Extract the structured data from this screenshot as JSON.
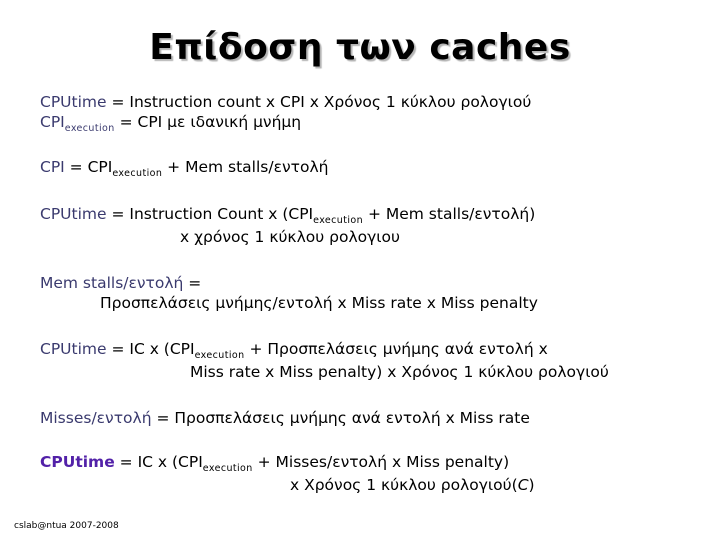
{
  "slide": {
    "title": "Επίδοση των caches",
    "footer": "cslab@ntua 2007-2008",
    "colors": {
      "background": "#ffffff",
      "title": "#000000",
      "title_shadow": "#8c8c8c",
      "lhs_blue": "#3a3a6e",
      "lhs_purple": "#5221a8",
      "body_text": "#000000"
    }
  },
  "equations": {
    "eq1": {
      "lhs": "CPUtime",
      "eq": " =  ",
      "rhs": "Instruction count x CPI  x Χρόνος 1 κύκλου ρολογιού"
    },
    "eq2": {
      "lhs": "CPI",
      "lhs_sub": "execution",
      "eq": "  =  ",
      "rhs": "CPI με ιδανική μνήμη"
    },
    "eq3": {
      "lhs": "CPI",
      "eq": " =   ",
      "rhs_pre": "CPI",
      "rhs_sub": "execution",
      "rhs_post": " + Mem stalls/εντολή"
    },
    "eq4": {
      "lhs": "CPUtime",
      "eq": " = ",
      "rhs_pre": "Instruction Count x  (CPI",
      "rhs_sub": "execution",
      "rhs_post": " + Mem stalls/εντολή)",
      "line2": "x  χρόνος 1 κύκλου ρολογιου"
    },
    "eq5": {
      "lhs": "Mem stalls/εντολή",
      "eq": " =",
      "line2": "Προσπελάσεις μνήμης/εντολή  x  Miss rate x Miss penalty"
    },
    "eq6": {
      "lhs": "CPUtime",
      "eq": " = ",
      "rhs_pre": "IC x  (CPI",
      "rhs_sub": "execution",
      "rhs_post": " + Προσπελάσεις μνήμης ανά εντολή x",
      "line2": "Miss rate x Miss penalty)  x Χρόνος 1 κύκλου ρολογιού"
    },
    "eq7": {
      "lhs": "Misses/εντολή",
      "eq": " = ",
      "rhs": "Προσπελάσεις μνήμης ανά εντολή x  Miss rate"
    },
    "eq8": {
      "lhs": "CPUtime",
      "eq": " =  ",
      "rhs_pre": "IC x (CPI",
      "rhs_sub": "execution",
      "rhs_post": " + Misses/εντολή x  Miss penalty)",
      "line2_pre": "x Χρόνος 1 κύκλου ρολογιού(",
      "line2_var": "C",
      "line2_post": ")"
    }
  }
}
